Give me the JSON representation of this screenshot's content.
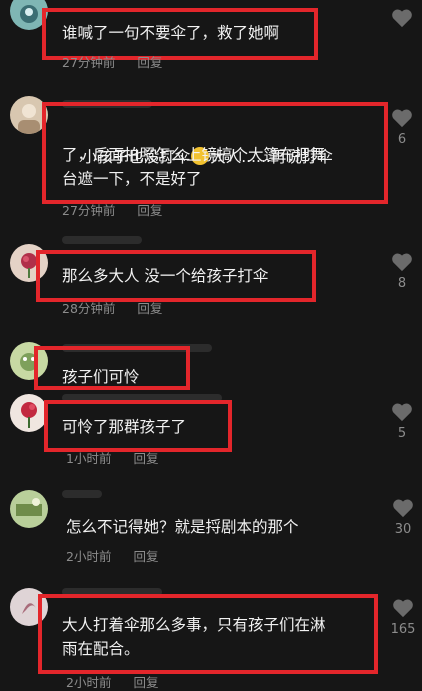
{
  "comments": [
    {
      "text": "谁喊了一句不要伞了，救了她啊",
      "time": "27分钟前",
      "reply": "回复",
      "likes": ""
    },
    {
      "text_a": "小孩子也没打伞",
      "text_b": "大人......再说打伞",
      "text_c": "了，后面拍照怎么上镜搞个大篷布把舞",
      "text_d": "台遮一下，不是好了",
      "time": "27分钟前",
      "reply": "回复",
      "likes": "6"
    },
    {
      "text": "那么多大人 没一个给孩子打伞",
      "time": "28分钟前",
      "reply": "回复",
      "likes": "8"
    },
    {
      "text": "孩子们可怜",
      "time": "",
      "reply": "",
      "likes": ""
    },
    {
      "text": "可怜了那群孩子了",
      "time": "1小时前",
      "reply": "回复",
      "likes": "5"
    },
    {
      "text": "怎么不记得她？就是捋剧本的那个",
      "time": "2小时前",
      "reply": "回复",
      "likes": "30"
    },
    {
      "text_a": "大人打着伞那么多事，只有孩子们在淋",
      "text_b": "雨在配合。",
      "time": "2小时前",
      "reply": "回复",
      "likes": "165"
    }
  ],
  "colors": {
    "highlight": "#e3262b",
    "background": "#161616"
  }
}
